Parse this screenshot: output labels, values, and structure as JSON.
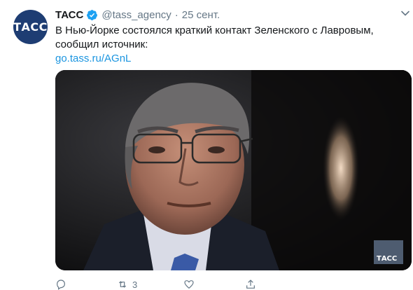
{
  "tweet": {
    "avatar_text": "ТАСС",
    "author_name": "ТАСС",
    "handle": "@tass_agency",
    "separator": "·",
    "date": "25 сент.",
    "text": "В Нью-Йорке состоялся краткий контакт Зеленского с Лавровым, сообщил источник:",
    "link": "go.tass.ru/AGnL",
    "media": {
      "description_icon": "photo",
      "watermark": "ТАСС"
    },
    "actions": {
      "reply_count": "",
      "retweet_count": "3",
      "like_count": "",
      "share_count": ""
    }
  },
  "colors": {
    "brand": "#1e3d73",
    "link": "#1b95e0",
    "verified": "#1da1f2",
    "muted": "#657786"
  }
}
